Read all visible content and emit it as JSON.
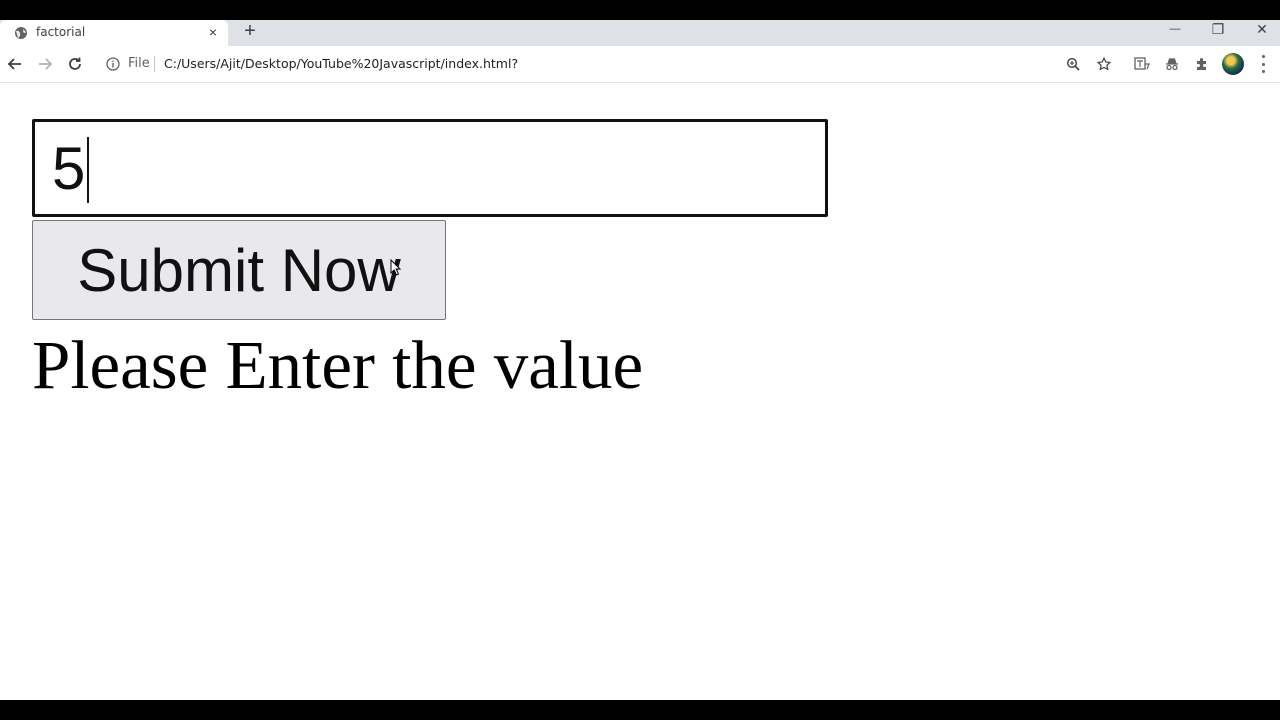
{
  "browser": {
    "tab": {
      "title": "factorial",
      "favicon": "globe-icon",
      "close": "×"
    },
    "new_tab": "+",
    "window_controls": {
      "minimize": "—",
      "restore": "❐",
      "close": "✕"
    },
    "omnibox": {
      "security_label": "File",
      "url": "C:/Users/Ajit/Desktop/YouTube%20Javascript/index.html?"
    }
  },
  "page": {
    "input_value": "5",
    "submit_label": "Submit Now",
    "result_text": "Please Enter the value"
  }
}
